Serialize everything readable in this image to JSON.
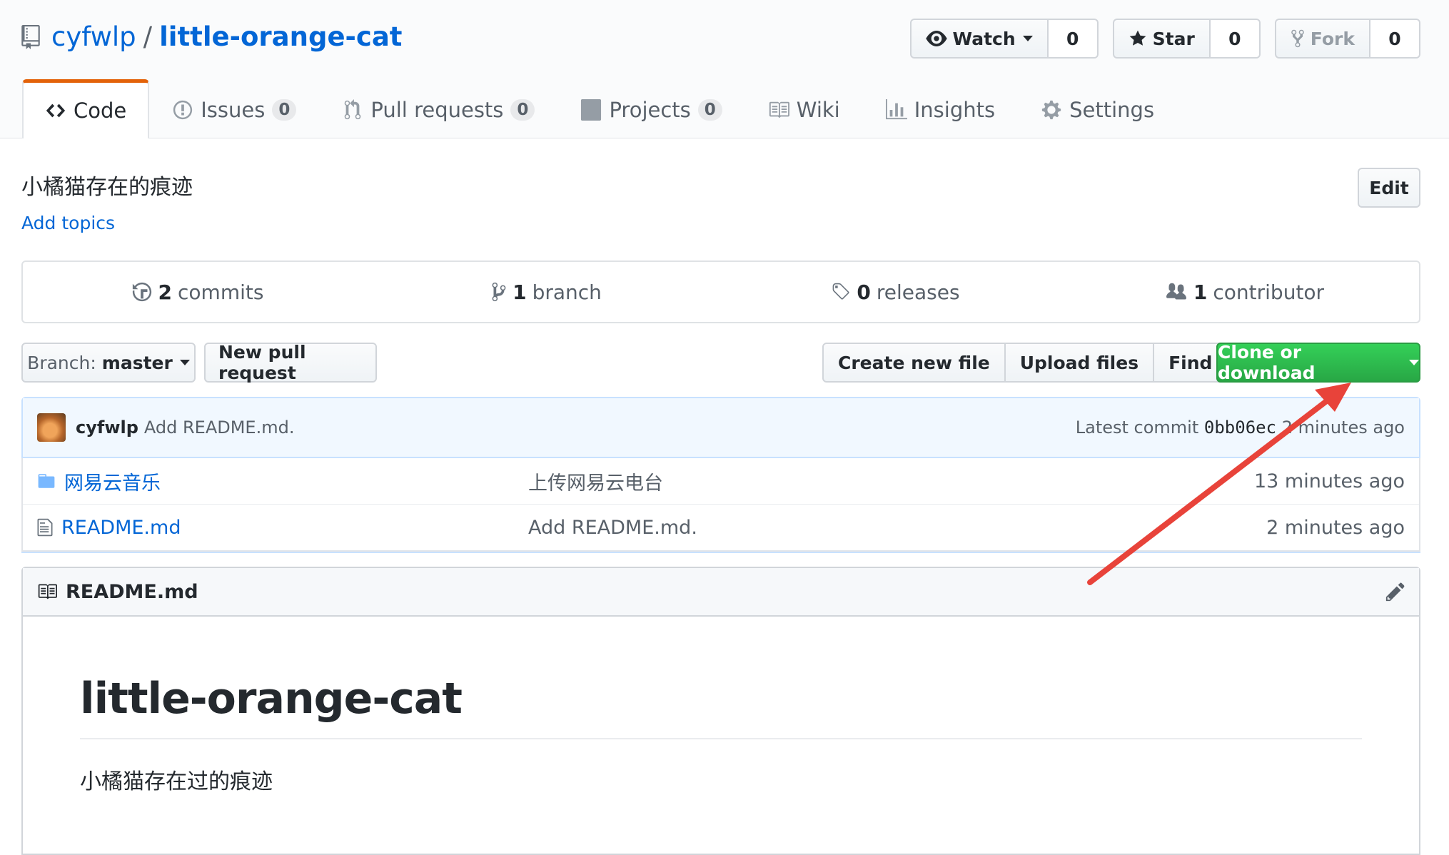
{
  "repo": {
    "owner": "cyfwlp",
    "separator": "/",
    "name": "little-orange-cat"
  },
  "actions": {
    "watch": {
      "label": "Watch",
      "count": "0"
    },
    "star": {
      "label": "Star",
      "count": "0"
    },
    "fork": {
      "label": "Fork",
      "count": "0"
    }
  },
  "nav": {
    "code": "Code",
    "issues": {
      "label": "Issues",
      "count": "0"
    },
    "pulls": {
      "label": "Pull requests",
      "count": "0"
    },
    "projects": {
      "label": "Projects",
      "count": "0"
    },
    "wiki": "Wiki",
    "insights": "Insights",
    "settings": "Settings"
  },
  "description": "小橘猫存在的痕迹",
  "add_topics": "Add topics",
  "edit_label": "Edit",
  "summary": {
    "commits": {
      "num": "2",
      "label": "commits"
    },
    "branches": {
      "num": "1",
      "label": "branch"
    },
    "releases": {
      "num": "0",
      "label": "releases"
    },
    "contributors": {
      "num": "1",
      "label": "contributor"
    }
  },
  "filenav": {
    "branch_prefix": "Branch:",
    "branch_name": "master",
    "new_pr": "New pull request",
    "create_file": "Create new file",
    "upload_files": "Upload files",
    "find_file": "Find file",
    "clone": "Clone or download"
  },
  "commit": {
    "author": "cyfwlp",
    "message": "Add README.md.",
    "latest_prefix": "Latest commit",
    "sha": "0bb06ec",
    "age": "2 minutes ago"
  },
  "files": [
    {
      "type": "dir",
      "name": "网易云音乐",
      "message": "上传网易云电台",
      "age": "13 minutes ago"
    },
    {
      "type": "file",
      "name": "README.md",
      "message": "Add README.md.",
      "age": "2 minutes ago"
    }
  ],
  "readme": {
    "header": "README.md",
    "title": "little-orange-cat",
    "body": "小橘猫存在过的痕迹"
  },
  "colors": {
    "link": "#0366d6",
    "clone_button": "#28a745",
    "selected_tab": "#e36209",
    "annotation_arrow": "#e8433a"
  }
}
